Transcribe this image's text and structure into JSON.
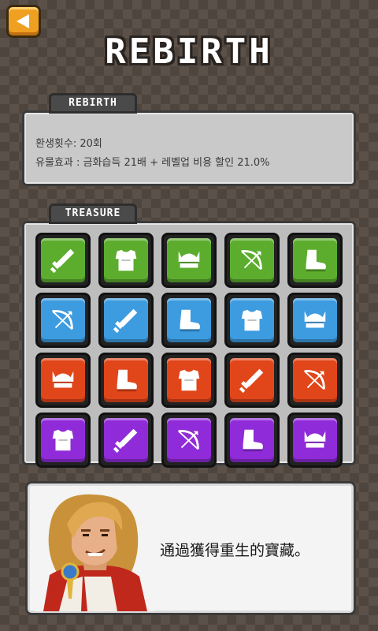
{
  "header": {
    "title": "REBIRTH",
    "back_icon": "back-arrow-icon"
  },
  "rebirth": {
    "tab_label": "REBIRTH",
    "count_line": "환생횟수: 20회",
    "effect_line": "유물효과 : 금화습득 21배 + 레벨업 비용 할인 21.0%"
  },
  "treasure": {
    "tab_label": "TREASURE",
    "colors": {
      "green": "#5cad2e",
      "blue": "#3d9be0",
      "red": "#e0461a",
      "purple": "#8f2bd8"
    },
    "rows": [
      {
        "color": "green",
        "items": [
          "sword",
          "armor",
          "helmet",
          "bow",
          "boots"
        ]
      },
      {
        "color": "blue",
        "items": [
          "bow",
          "sword",
          "boots",
          "armor",
          "helmet"
        ]
      },
      {
        "color": "red",
        "items": [
          "helmet",
          "boots",
          "armor",
          "sword",
          "bow"
        ]
      },
      {
        "color": "purple",
        "items": [
          "armor",
          "sword",
          "bow",
          "boots",
          "helmet"
        ]
      }
    ]
  },
  "dialog": {
    "text": "通過獲得重生的寶藏。",
    "portrait": "hero-portrait"
  }
}
